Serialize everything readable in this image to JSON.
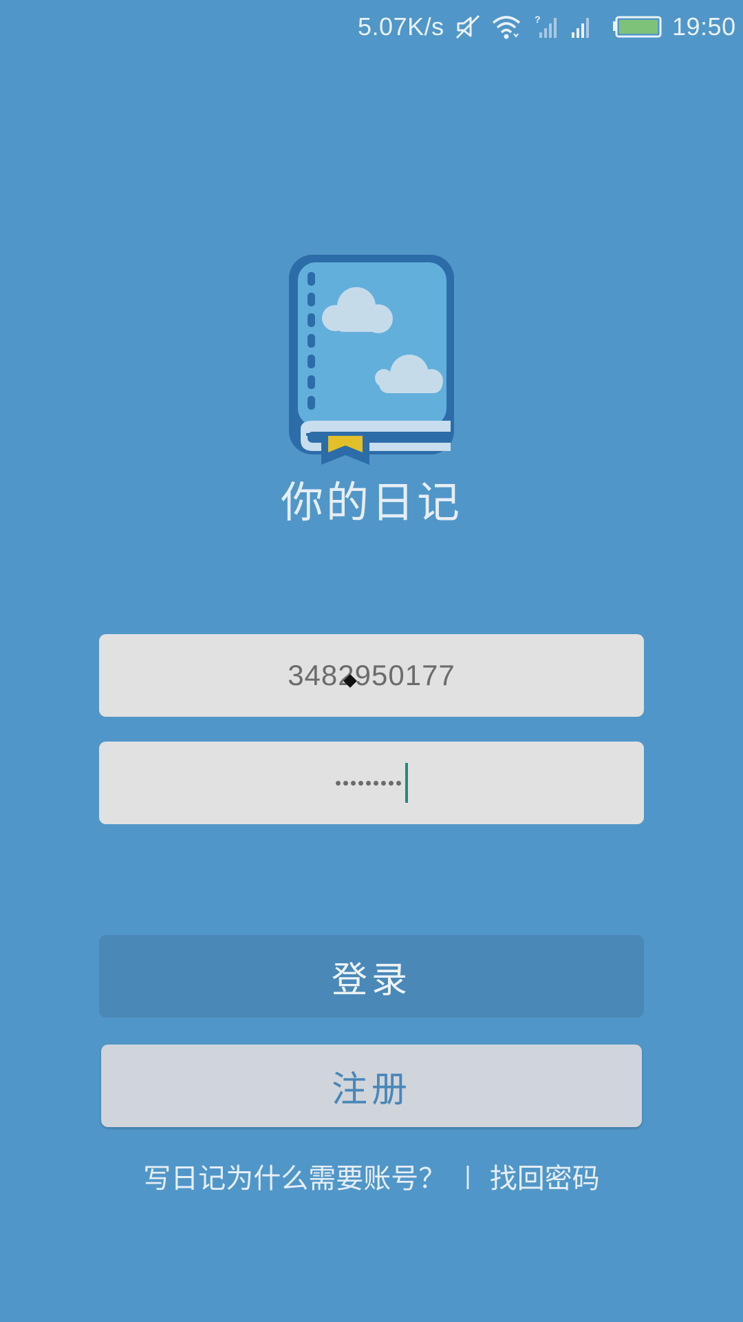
{
  "status_bar": {
    "net_speed": "5.07K/s",
    "time": "19:50",
    "icons": [
      "mute-icon",
      "wifi-icon",
      "no-sim-signal-icon",
      "cell-signal-icon",
      "battery-icon"
    ],
    "battery_color": "#7ec27a"
  },
  "app": {
    "title": "你的日记",
    "logo_icon": "diary-book-icon",
    "background_color": "#5196c8"
  },
  "form": {
    "username_value": "3482950177",
    "password_mask_count": 9
  },
  "buttons": {
    "login_label": "登录",
    "register_label": "注册"
  },
  "links": {
    "why_account": "写日记为什么需要账号？",
    "separator": "|",
    "forgot_password": "找回密码"
  }
}
